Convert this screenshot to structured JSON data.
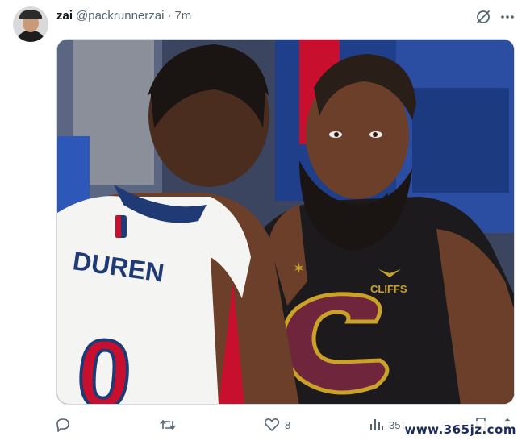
{
  "post": {
    "author": {
      "display_name": "zai",
      "handle": "@packrunnerzai",
      "separator": "·",
      "time": "7m",
      "avatar_icon": "user-avatar"
    },
    "header_icons": [
      "grok-icon",
      "more-icon"
    ],
    "media": {
      "jersey_name": "DUREN",
      "jersey_number": "0",
      "sponsor_patch": "CLIFFS",
      "colors": {
        "background": "#2f3a57",
        "white_jersey": "#f4f4f2",
        "jersey_blue": "#1f3a75",
        "jersey_red": "#c8102e",
        "black_jersey": "#1c1a1c",
        "wine": "#6f263d",
        "gold": "#c9a227",
        "skin": "#6b3f2a"
      }
    },
    "actions": {
      "reply_count": "",
      "repost_count": "",
      "like_count": "8",
      "views_count": "351",
      "icons": [
        "reply-icon",
        "repost-icon",
        "like-icon",
        "views-icon",
        "bookmark-icon",
        "share-icon"
      ]
    }
  },
  "watermark": "www.365jz.com"
}
